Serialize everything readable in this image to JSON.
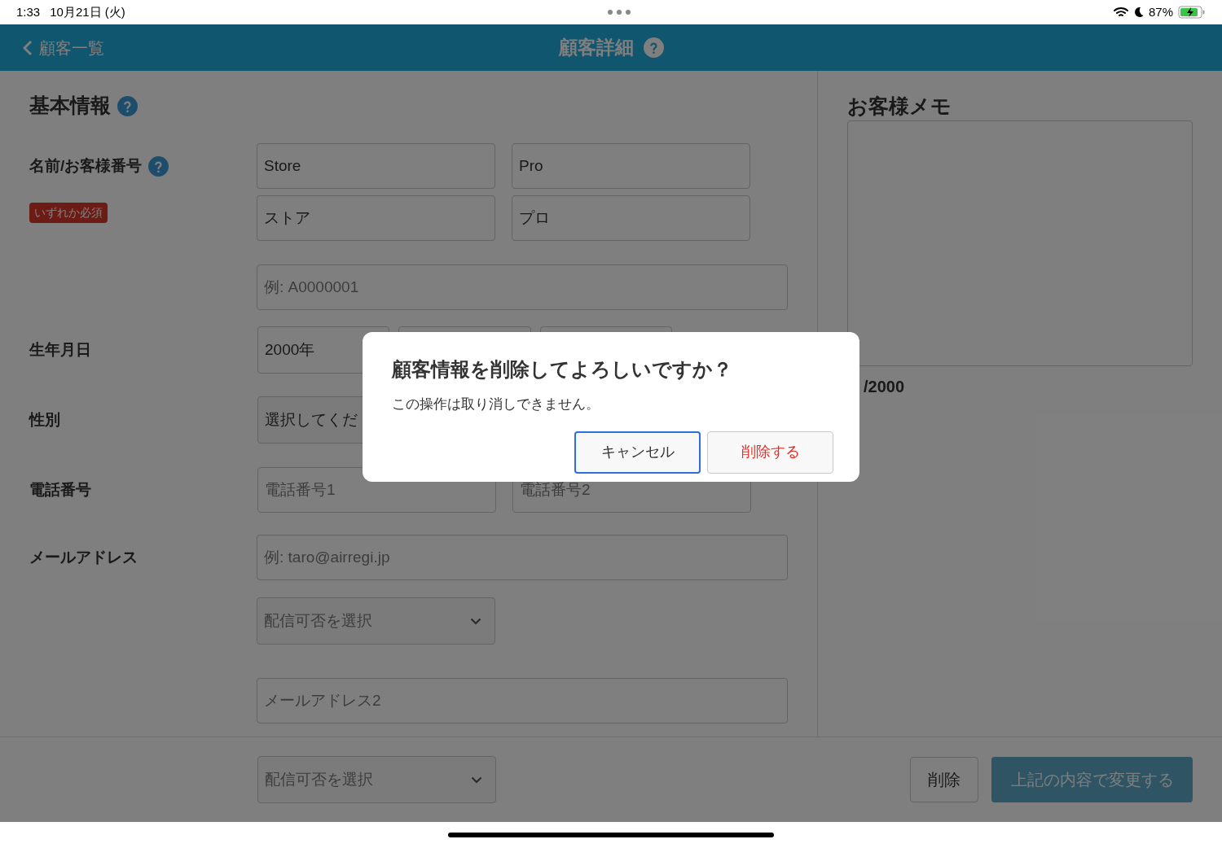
{
  "status_bar": {
    "time": "1:33",
    "date": "10月21日 (火)",
    "battery": "87%"
  },
  "nav": {
    "back": "顧客一覧",
    "title": "顧客詳細"
  },
  "basic_info": {
    "title": "基本情報",
    "name": {
      "label": "名前/お客様番号",
      "badge": "いずれか必須",
      "last_name": "Store",
      "first_name": "Pro",
      "last_kana": "ストア",
      "first_kana": "プロ",
      "number_placeholder": "例: A0000001"
    },
    "birthday": {
      "label": "生年月日",
      "year": "2000年"
    },
    "gender": {
      "label": "性別",
      "value": "選択してくだ"
    },
    "phone": {
      "label": "電話番号",
      "placeholder_1": "電話番号1",
      "placeholder_2": "電話番号2"
    },
    "email": {
      "label": "メールアドレス",
      "placeholder": "例: taro@airregi.jp",
      "delivery_placeholder": "配信可否を選択",
      "placeholder_2": "メールアドレス2",
      "delivery_placeholder_2": "配信可否を選択"
    }
  },
  "memo": {
    "title": "お客様メモ",
    "counter": "/2000"
  },
  "footer": {
    "buttons": [
      {
        "label": "削除",
        "kind": "secondary",
        "disabled": false
      },
      {
        "label": "上記の内容で変更する",
        "kind": "primary",
        "disabled": true
      }
    ]
  },
  "dialog": {
    "title": "顧客情報を削除してよろしいですか？",
    "message": "この操作は取り消しできません。",
    "buttons": [
      {
        "label": "キャンセル",
        "kind": "cancel",
        "focused": true
      },
      {
        "label": "削除する",
        "kind": "destructive",
        "focused": false
      }
    ]
  }
}
